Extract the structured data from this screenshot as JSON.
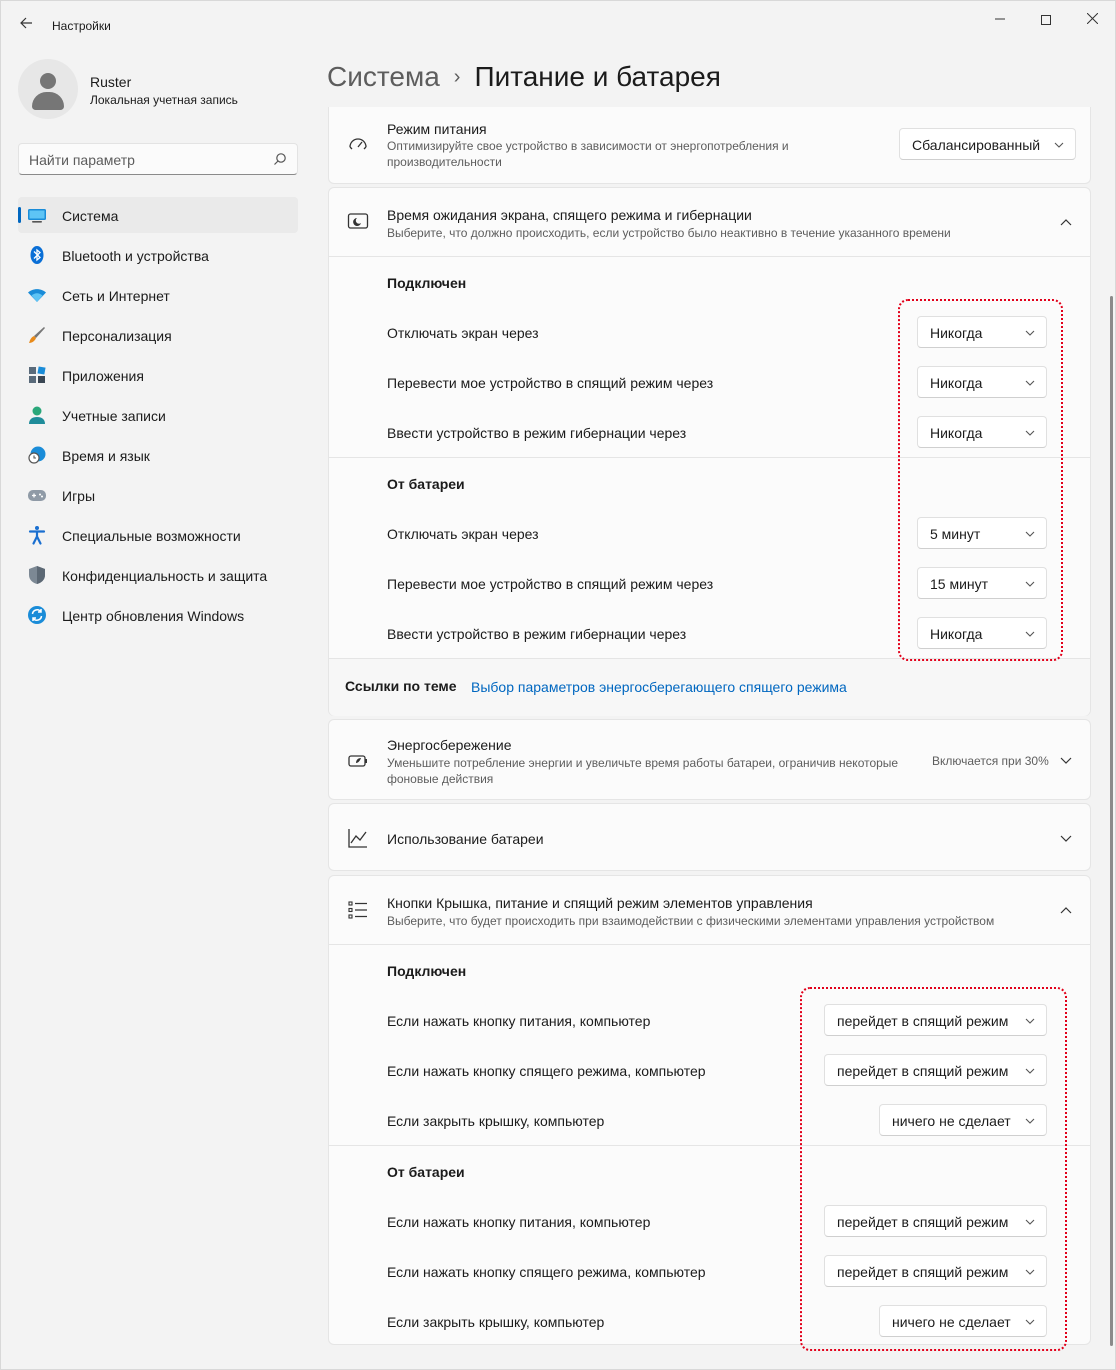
{
  "app": {
    "title": "Настройки"
  },
  "user": {
    "name": "Ruster",
    "account_type": "Локальная учетная запись"
  },
  "search": {
    "placeholder": "Найти параметр"
  },
  "sidebar": {
    "items": [
      {
        "label": "Система",
        "icon": "system-icon",
        "active": true
      },
      {
        "label": "Bluetooth и устройства",
        "icon": "bluetooth-icon"
      },
      {
        "label": "Сеть и Интернет",
        "icon": "wifi-icon"
      },
      {
        "label": "Персонализация",
        "icon": "brush-icon"
      },
      {
        "label": "Приложения",
        "icon": "apps-icon"
      },
      {
        "label": "Учетные записи",
        "icon": "account-icon"
      },
      {
        "label": "Время и язык",
        "icon": "time-language-icon"
      },
      {
        "label": "Игры",
        "icon": "gamepad-icon"
      },
      {
        "label": "Специальные возможности",
        "icon": "accessibility-icon"
      },
      {
        "label": "Конфиденциальность и защита",
        "icon": "shield-icon"
      },
      {
        "label": "Центр обновления Windows",
        "icon": "update-icon"
      }
    ]
  },
  "breadcrumb": {
    "parent": "Система",
    "separator": "›",
    "current": "Питание и батарея"
  },
  "power_mode": {
    "title": "Режим питания",
    "description": "Оптимизируйте свое устройство в зависимости от энергопотребления и производительности",
    "value": "Сбалансированный"
  },
  "screen_sleep": {
    "title": "Время ожидания экрана, спящего режима и гибернации",
    "description": "Выберите, что должно происходить, если устройство было неактивно в течение указанного времени",
    "plugged_in": {
      "heading": "Подключен",
      "rows": [
        {
          "label": "Отключать экран через",
          "value": "Никогда"
        },
        {
          "label": "Перевести мое устройство в спящий режим через",
          "value": "Никогда"
        },
        {
          "label": "Ввести устройство в режим гибернации через",
          "value": "Никогда"
        }
      ]
    },
    "on_battery": {
      "heading": "От батареи",
      "rows": [
        {
          "label": "Отключать экран через",
          "value": "5 минут"
        },
        {
          "label": "Перевести мое устройство в спящий режим через",
          "value": "15 минут"
        },
        {
          "label": "Ввести устройство в режим гибернации через",
          "value": "Никогда"
        }
      ]
    },
    "related_label": "Ссылки по теме",
    "related_link": "Выбор параметров энергосберегающего спящего режима"
  },
  "battery_saver": {
    "title": "Энергосбережение",
    "description": "Уменьшите потребление энергии и увеличьте время работы батареи, ограничив некоторые фоновые действия",
    "status": "Включается при 30%"
  },
  "battery_usage": {
    "title": "Использование батареи"
  },
  "lid_buttons": {
    "title": "Кнопки Крышка, питание и спящий режим элементов управления",
    "description": "Выберите, что будет происходить при взаимодействии с физическими элементами управления устройством",
    "plugged_in": {
      "heading": "Подключен",
      "rows": [
        {
          "label": "Если нажать кнопку питания, компьютер",
          "value": "перейдет в спящий режим"
        },
        {
          "label": "Если нажать кнопку спящего режима, компьютер",
          "value": "перейдет в спящий режим"
        },
        {
          "label": "Если закрыть крышку, компьютер",
          "value": "ничего не сделает"
        }
      ]
    },
    "on_battery": {
      "heading": "От батареи",
      "rows": [
        {
          "label": "Если нажать кнопку питания, компьютер",
          "value": "перейдет в спящий режим"
        },
        {
          "label": "Если нажать кнопку спящего режима, компьютер",
          "value": "перейдет в спящий режим"
        },
        {
          "label": "Если закрыть крышку, компьютер",
          "value": "ничего не сделает"
        }
      ]
    }
  },
  "colors": {
    "accent": "#0067c0",
    "highlight": "#e2001a"
  }
}
